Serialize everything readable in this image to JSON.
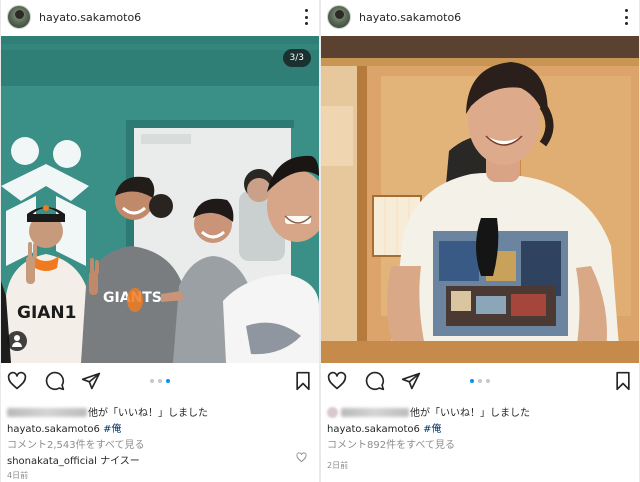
{
  "posts": [
    {
      "username": "hayato.sakamoto6",
      "counter": "3/3",
      "likes_suffix": "他が「いいね！」しました",
      "caption_user": "hayato.sakamoto6",
      "caption_tag": "#俺",
      "comments_link": "コメント2,543件をすべて見る",
      "comment_user": "shonakata_official",
      "comment_text": "ナイスー",
      "time": "4日前",
      "carousel": {
        "count": 3,
        "active": 3
      }
    },
    {
      "username": "hayato.sakamoto6",
      "likes_suffix": "他が「いいね！」しました",
      "caption_user": "hayato.sakamoto6",
      "caption_tag": "#俺",
      "comments_link": "コメント892件をすべて見る",
      "time": "2日前",
      "carousel": {
        "count": 3,
        "active": 1
      }
    }
  ],
  "icons": {
    "like": "heart-icon",
    "comment": "comment-icon",
    "share": "paper-plane-icon",
    "save": "bookmark-icon",
    "more": "more-vertical-icon",
    "user_tag": "person-icon"
  },
  "colors": {
    "link": "#00376b",
    "muted": "#8e8e8e",
    "text": "#262626",
    "active_dot": "#0095f6",
    "team_green": "#2f8c7c",
    "giants_orange": "#f07a20"
  }
}
